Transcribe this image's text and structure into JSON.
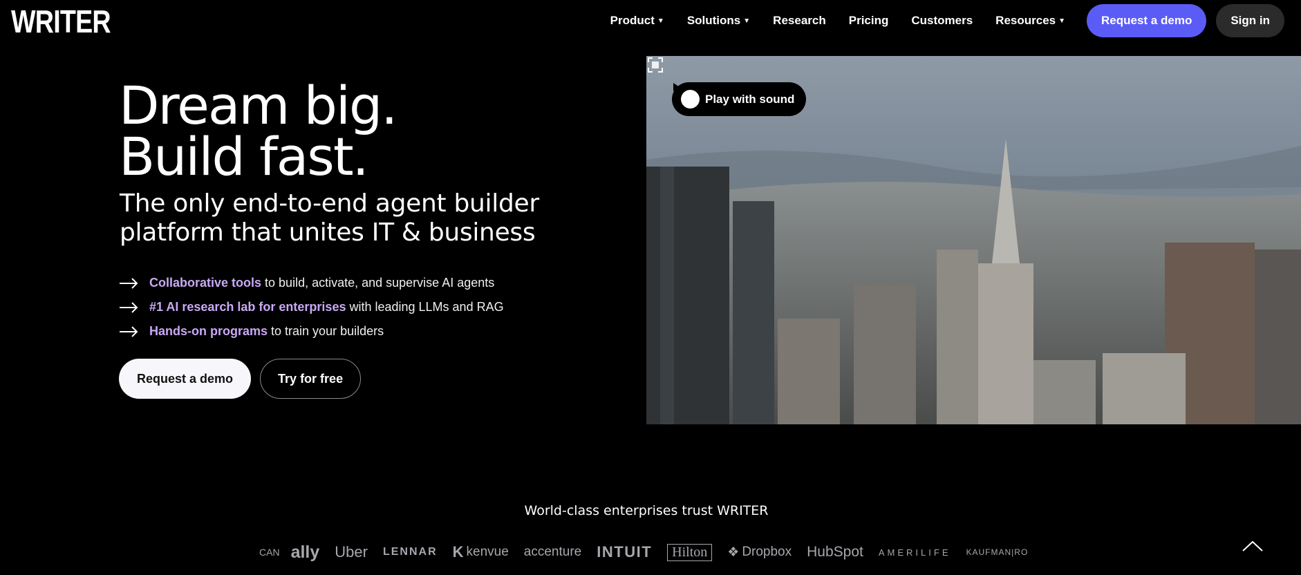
{
  "header": {
    "logo": "WRITER",
    "nav": [
      {
        "label": "Product",
        "caret": true
      },
      {
        "label": "Solutions",
        "caret": true
      },
      {
        "label": "Research",
        "caret": false
      },
      {
        "label": "Pricing",
        "caret": false
      },
      {
        "label": "Customers",
        "caret": false
      },
      {
        "label": "Resources",
        "caret": true
      }
    ],
    "demo_label": "Request a demo",
    "signin_label": "Sign in"
  },
  "hero": {
    "title_line1": "Dream big.",
    "title_line2": "Build fast.",
    "subtitle": "The only end-to-end agent builder platform that unites IT & business",
    "bullets": [
      {
        "highlight": "Collaborative tools",
        "rest": "to build, activate, and supervise AI agents"
      },
      {
        "highlight": "#1 AI research lab for enterprises",
        "rest": "with leading LLMs and RAG"
      },
      {
        "highlight": "Hands-on programs",
        "rest": "to train your builders"
      }
    ],
    "primary_cta": "Request a demo",
    "secondary_cta": "Try for free"
  },
  "video": {
    "play_label": "Play with sound"
  },
  "trust": {
    "heading": "World-class enterprises trust WRITER",
    "logos": [
      "CAN",
      "ally",
      "Uber",
      "LENNAR",
      "kenvue",
      "accenture",
      "INTUIT",
      "Hilton",
      "Dropbox",
      "HubSpot",
      "AMERILIFE",
      "KAUFMAN|RO"
    ]
  },
  "colors": {
    "accent": "#5b5cf6",
    "highlight": "#c9a8f5",
    "background": "#000000",
    "logo_gray": "#a7a7ad"
  }
}
